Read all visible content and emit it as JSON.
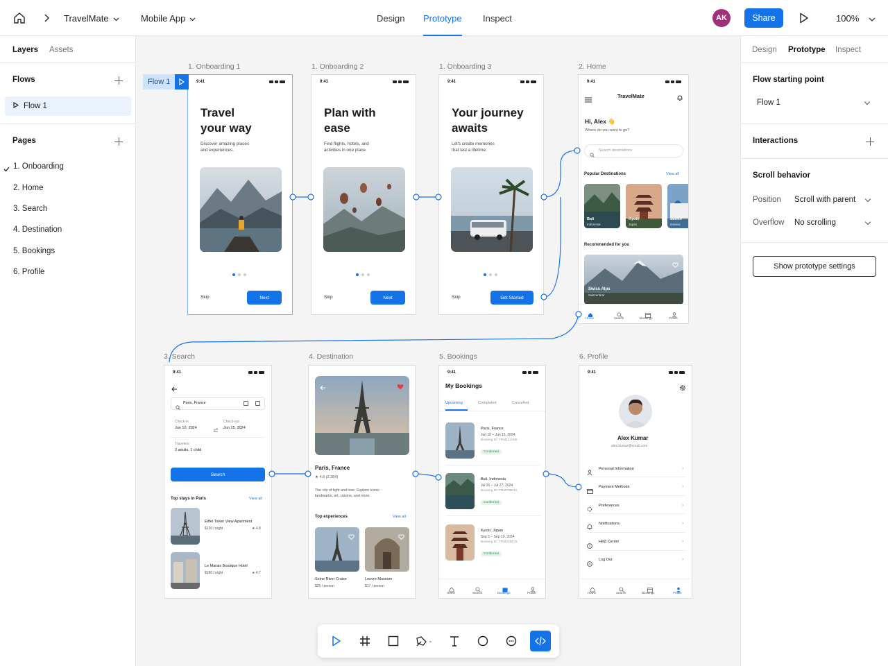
{
  "topbar": {
    "project": "TravelMate",
    "file": "Mobile App",
    "tabs": [
      "Design",
      "Prototype",
      "Inspect"
    ],
    "active_tab": "Prototype",
    "avatar_initials": "AK",
    "share_label": "Share",
    "zoom": "100%"
  },
  "left": {
    "tabs": [
      "Layers",
      "Assets"
    ],
    "flows_title": "Flows",
    "flow_item": "Flow 1",
    "pages_title": "Pages",
    "pages": [
      "1. Onboarding",
      "2. Home",
      "3. Search",
      "4. Destination",
      "5. Bookings",
      "6. Profile"
    ]
  },
  "right": {
    "tabs": [
      "Design",
      "Prototype",
      "Inspect"
    ],
    "flow_start_title": "Flow starting point",
    "flow_start_value": "Flow 1",
    "interactions_title": "Interactions",
    "scroll_title": "Scroll behavior",
    "position_label": "Position",
    "position_value": "Scroll with parent",
    "overflow_label": "Overflow",
    "overflow_value": "No scrolling",
    "settings_button": "Show prototype settings"
  },
  "canvas": {
    "flow_tag": "Flow 1",
    "status_time": "9:41",
    "frames": {
      "onb1": {
        "label": "1. Onboarding 1",
        "title": "Travel\nyour way",
        "sub": "Discover amazing places\nand experiences.",
        "skip": "Skip",
        "cta": "Next"
      },
      "onb2": {
        "label": "1. Onboarding 2",
        "title": "Plan with\nease",
        "sub": "Find flights, hotels, and\nactivities in one place.",
        "skip": "Skip",
        "cta": "Next"
      },
      "onb3": {
        "label": "1. Onboarding 3",
        "title": "Your journey\nawaits",
        "sub": "Let's create memories\nthat last a lifetime.",
        "skip": "Skip",
        "cta": "Get Started"
      },
      "home": {
        "label": "2. Home",
        "app": "TravelMate",
        "greet": "Hi, Alex 👋",
        "greet_sub": "Where do you want to go?",
        "search": "Search destinations",
        "popular": "Popular Destinations",
        "view_all": "View all",
        "dest": [
          {
            "name": "Bali",
            "country": "Indonesia"
          },
          {
            "name": "Kyoto",
            "country": "Japan"
          },
          {
            "name": "Santor",
            "country": "Greece"
          }
        ],
        "recommended": "Recommended for you",
        "rec_name": "Swiss Alps",
        "rec_country": "Switzerland",
        "nav": [
          "Home",
          "Search",
          "Bookings",
          "Profile"
        ]
      },
      "search": {
        "label": "3. Search",
        "query": "Paris, France",
        "checkin_label": "Check-in",
        "checkin": "Jun 10, 2024",
        "checkout_label": "Check-out",
        "checkout": "Jun 15, 2024",
        "travelers_label": "Travelers",
        "travelers": "2 adults, 1 child",
        "button": "Search",
        "top": "Top stays in Paris",
        "view_all": "View all",
        "stays": [
          {
            "name": "Eiffel Tower View Apartment",
            "price": "$120 / night",
            "rating": "4.8"
          },
          {
            "name": "Le Marais Boutique Hotel",
            "price": "$180 / night",
            "rating": "4.7"
          }
        ]
      },
      "dest": {
        "label": "4. Destination",
        "name": "Paris, France",
        "rating": "4.8",
        "reviews": "(2,384)",
        "desc": "The city of light and love. Explore iconic\nlandmarks, art, cuisine, and more.",
        "exp_title": "Top experiences",
        "view_all": "View all",
        "exp": [
          {
            "name": "Seine River Cruise",
            "price": "$25 / person"
          },
          {
            "name": "Louvre Museum",
            "price": "$17 / person"
          }
        ]
      },
      "bookings": {
        "label": "5. Bookings",
        "title": "My Bookings",
        "tabs": [
          "Upcoming",
          "Completed",
          "Cancelled"
        ],
        "items": [
          {
            "place": "Paris, France",
            "dates": "Jun 10 – Jun 15, 2024",
            "id": "Booking ID: TRM124456",
            "status": "Confirmed"
          },
          {
            "place": "Bali, Indonesia",
            "dates": "Jul 20 – Jul 27, 2024",
            "id": "Booking ID: TRM789012",
            "status": "Confirmed"
          },
          {
            "place": "Kyoto, Japan",
            "dates": "Sep 5 – Sep 10, 2024",
            "id": "Booking ID: TRM345678",
            "status": "Confirmed"
          }
        ],
        "nav": [
          "Home",
          "Search",
          "Bookings",
          "Profile"
        ]
      },
      "profile": {
        "label": "6. Profile",
        "name": "Alex Kumar",
        "email": "alex.kumar@email.com",
        "menu": [
          "Personal Information",
          "Payment Methods",
          "Preferences",
          "Notifications",
          "Help Center",
          "Log Out"
        ],
        "nav": [
          "Home",
          "Search",
          "Bookings",
          "Profile"
        ]
      }
    }
  },
  "colors": {
    "accent": "#1473e6",
    "avatar": "#a0307a",
    "confirmed": "#2e9b4f"
  }
}
